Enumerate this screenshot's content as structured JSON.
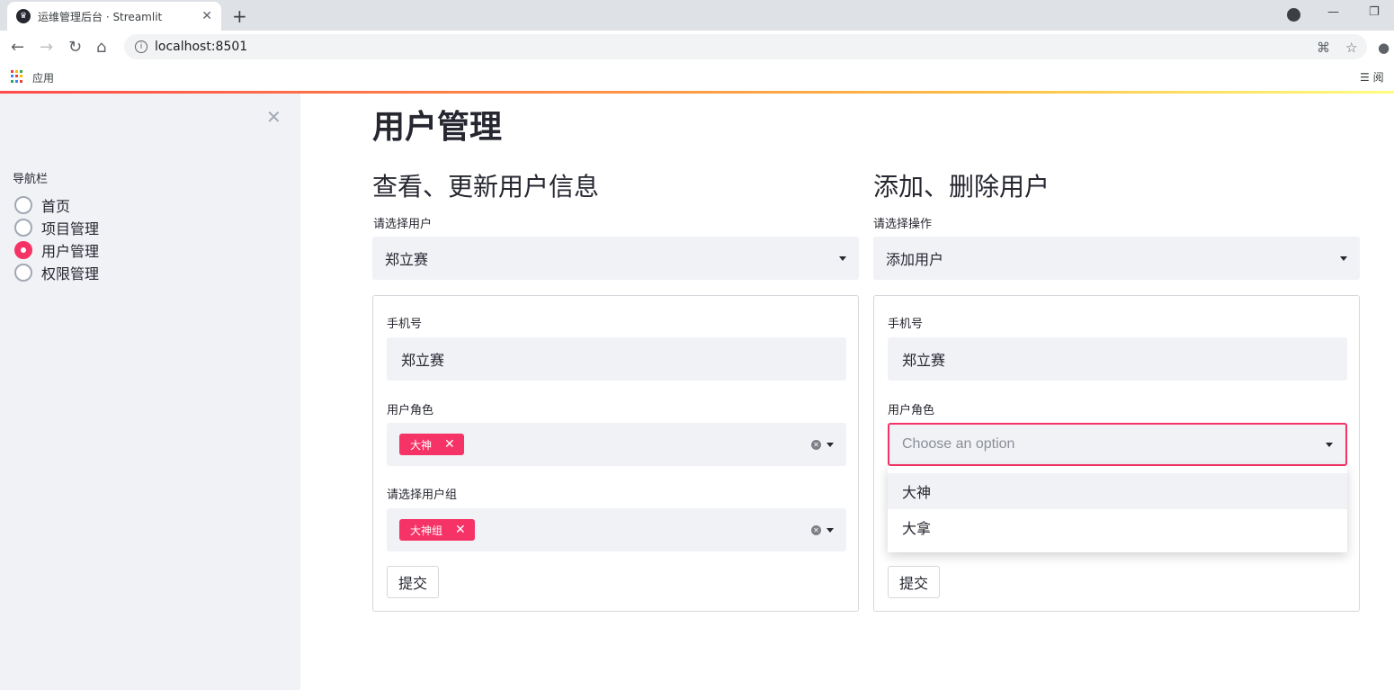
{
  "browser": {
    "tab_title": "运维管理后台 · Streamlit",
    "url": "localhost:8501",
    "bookmark_apps": "应用",
    "reader_label": "阅"
  },
  "sidebar": {
    "nav_label": "导航栏",
    "items": [
      {
        "label": "首页",
        "selected": false
      },
      {
        "label": "项目管理",
        "selected": false
      },
      {
        "label": "用户管理",
        "selected": true
      },
      {
        "label": "权限管理",
        "selected": false
      }
    ]
  },
  "main": {
    "title": "用户管理",
    "left": {
      "heading": "查看、更新用户信息",
      "select_label": "请选择用户",
      "select_value": "郑立赛",
      "phone_label": "手机号",
      "phone_value": "郑立赛",
      "role_label": "用户角色",
      "role_tag": "大神",
      "group_label": "请选择用户组",
      "group_tag": "大神组",
      "submit_label": "提交"
    },
    "right": {
      "heading": "添加、删除用户",
      "select_label": "请选择操作",
      "select_value": "添加用户",
      "phone_label": "手机号",
      "phone_value": "郑立赛",
      "role_label": "用户角色",
      "role_placeholder": "Choose an option",
      "role_options": [
        "大神",
        "大拿"
      ],
      "submit_label": "提交"
    }
  },
  "colors": {
    "accent": "#f63366",
    "sidebar_bg": "#f0f2f6"
  }
}
